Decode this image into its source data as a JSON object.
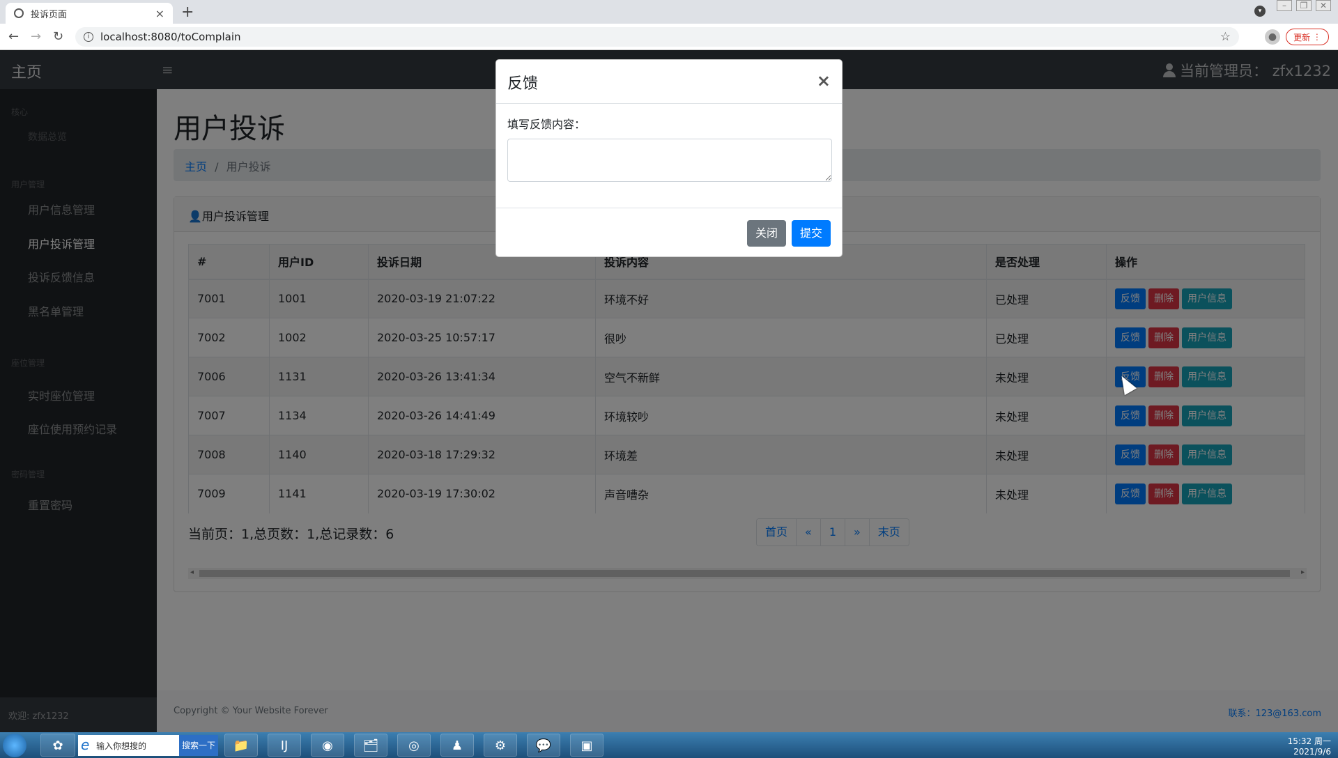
{
  "browser": {
    "tab_title": "投诉页面",
    "tab_close": "×",
    "new_tab": "+",
    "url": "localhost:8080/toComplain",
    "update_label": "更新"
  },
  "app": {
    "brand": "主页",
    "toggler": "≡",
    "admin_label": "当前管理员： zfx1232"
  },
  "sidebar": {
    "heading_core": "核心",
    "item_overview": "数据总览",
    "heading_user": "用户管理",
    "items_user": [
      "用户信息管理",
      "用户投诉管理",
      "投诉反馈信息",
      "黑名单管理"
    ],
    "heading_seat": "座位管理",
    "items_seat": [
      "实时座位管理",
      "座位使用预约记录"
    ],
    "heading_pwd": "密码管理",
    "item_reset": "重置密码",
    "footer": "欢迎: zfx1232"
  },
  "page": {
    "title": "用户投诉",
    "breadcrumb_home": "主页",
    "breadcrumb_sep": "/",
    "breadcrumb_current": "用户投诉",
    "card_title": "用户投诉管理"
  },
  "table": {
    "headers": [
      "#",
      "用户ID",
      "投诉日期",
      "投诉内容",
      "是否处理",
      "操作"
    ],
    "rows": [
      [
        "7001",
        "1001",
        "2020-03-19 21:07:22",
        "环境不好",
        "已处理"
      ],
      [
        "7002",
        "1002",
        "2020-03-25 10:57:17",
        "很吵",
        "已处理"
      ],
      [
        "7006",
        "1131",
        "2020-03-26 13:41:34",
        "空气不新鲜",
        "未处理"
      ],
      [
        "7007",
        "1134",
        "2020-03-26 14:41:49",
        "环境较吵",
        "未处理"
      ],
      [
        "7008",
        "1140",
        "2020-03-18 17:29:32",
        "环境差",
        "未处理"
      ],
      [
        "7009",
        "1141",
        "2020-03-19 17:30:02",
        "声音嘈杂",
        "未处理"
      ]
    ],
    "btn_feedback": "反馈",
    "btn_delete": "删除",
    "btn_userinfo": "用户信息"
  },
  "pager": {
    "info": "当前页：1,总页数：1,总记录数：6",
    "first": "首页",
    "prev": "«",
    "page": "1",
    "next": "»",
    "last": "末页"
  },
  "footer": {
    "copyright": "Copyright © Your Website Forever",
    "contact": "联系：123@163.com"
  },
  "modal": {
    "title": "反馈",
    "close_x": "×",
    "label": "填写反馈内容：",
    "textarea_value": "",
    "btn_close": "关闭",
    "btn_submit": "提交"
  },
  "taskbar": {
    "search_placeholder": "输入你想搜的",
    "search_button": "搜索一下",
    "time": "15:32 周一",
    "date": "2021/9/6"
  },
  "colors": {
    "primary": "#007bff",
    "danger": "#dc3545",
    "info": "#17a2b8",
    "secondary": "#6c757d",
    "navbar": "#343a40",
    "sidebar": "#212529"
  }
}
